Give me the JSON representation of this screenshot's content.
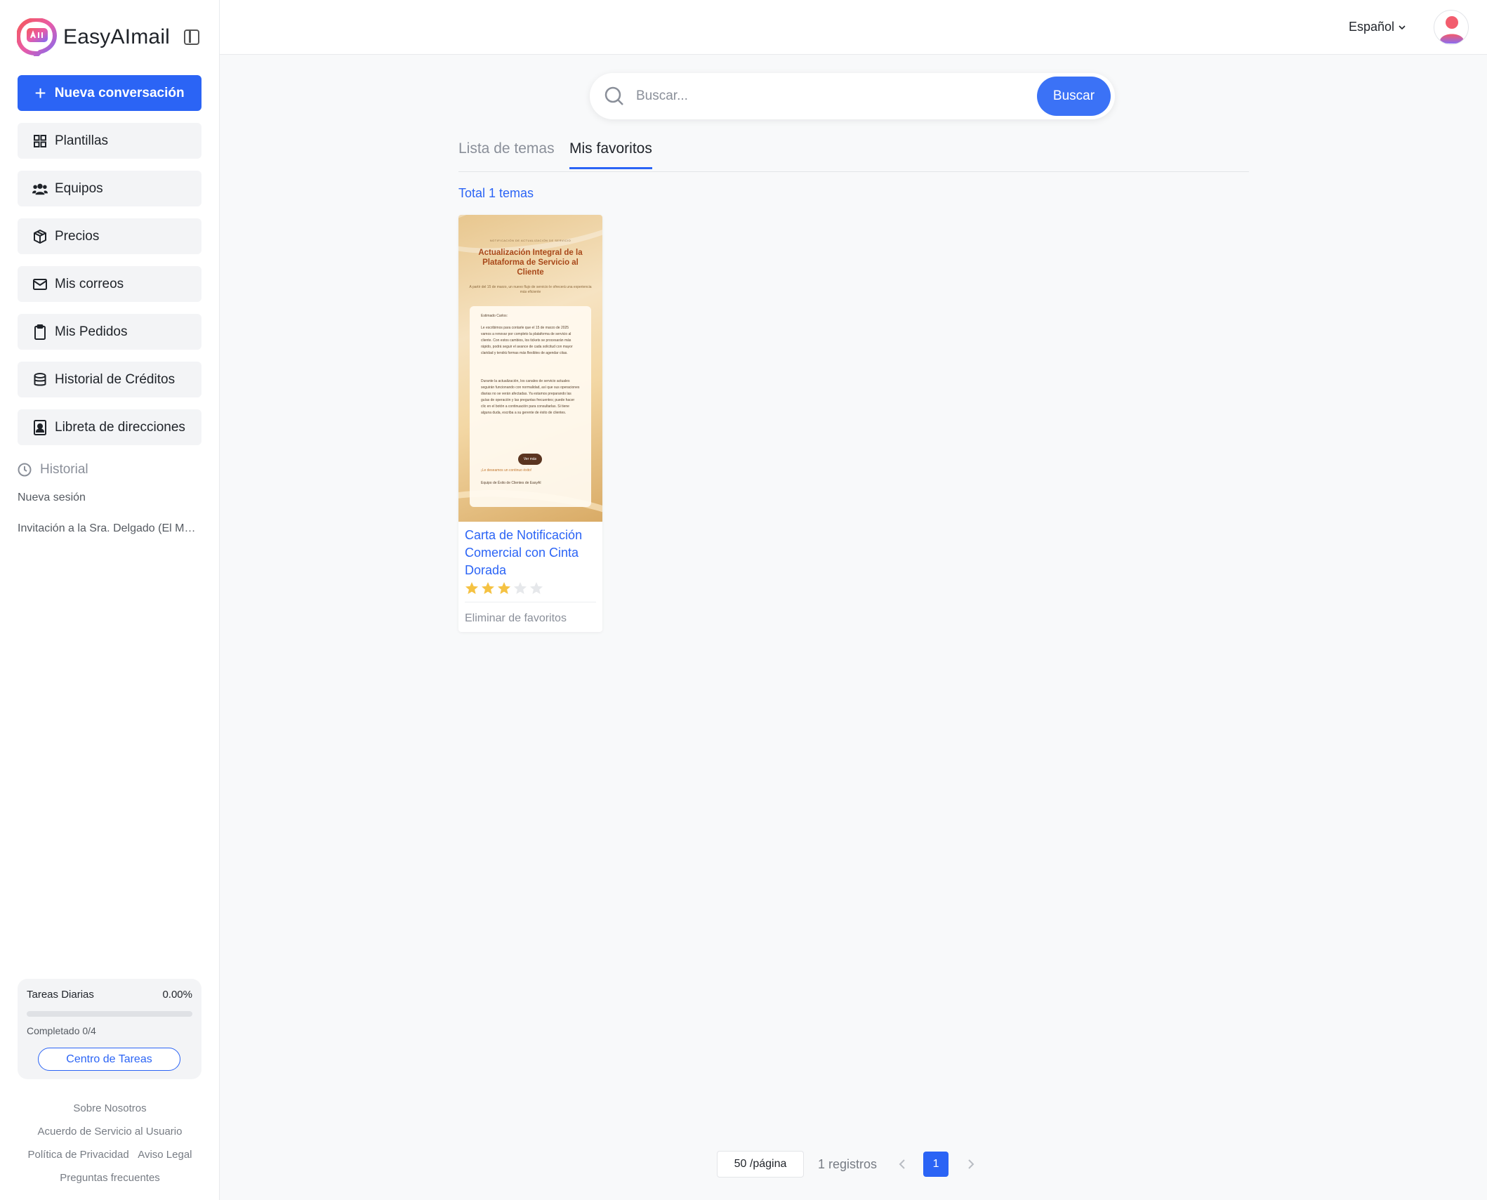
{
  "brand": {
    "name": "EasyAImail"
  },
  "sidebar": {
    "new_conversation": "Nueva conversación",
    "items": [
      {
        "label": "Plantillas",
        "icon": "grid-icon"
      },
      {
        "label": "Equipos",
        "icon": "team-icon"
      },
      {
        "label": "Precios",
        "icon": "box-icon"
      },
      {
        "label": "Mis correos",
        "icon": "mail-icon"
      },
      {
        "label": "Mis Pedidos",
        "icon": "clipboard-icon"
      },
      {
        "label": "Historial de Créditos",
        "icon": "database-icon"
      },
      {
        "label": "Libreta de direcciones",
        "icon": "contact-book-icon"
      }
    ],
    "history_title": "Historial",
    "history": [
      "Nueva sesión",
      "Invitación a la Sra. Delgado (El Mo…"
    ]
  },
  "tasks": {
    "title": "Tareas Diarias",
    "percent_text": "0.00%",
    "progress": 0,
    "completed": "Completado 0/4",
    "button": "Centro de Tareas"
  },
  "footer": {
    "about": "Sobre Nosotros",
    "terms": "Acuerdo de Servicio al Usuario",
    "privacy": "Política de Privacidad",
    "legal": "Aviso Legal",
    "faq": "Preguntas frecuentes"
  },
  "topbar": {
    "language": "Español"
  },
  "search": {
    "placeholder": "Buscar...",
    "button": "Buscar"
  },
  "tabs": [
    {
      "label": "Lista de temas",
      "active": false
    },
    {
      "label": "Mis favoritos",
      "active": true
    }
  ],
  "total_text": "Total 1 temas",
  "cards": [
    {
      "thumbnail": {
        "kicker": "NOTIFICACIÓN DE ACTUALIZACIÓN DE SERVICIO",
        "title": "Actualización Integral de la Plataforma de Servicio al Cliente",
        "subtitle": "A partir del 15 de marzo, un nuevo flujo de servicio le ofrecerá una experiencia más eficiente",
        "greeting": "Estimado Carlos:",
        "para1": "Le escribimos para contarle que el 15 de marzo de 2025 vamos a renovar por completo la plataforma de servicio al cliente. Con estos cambios, los tickets se procesarán más rápido, podrá seguir el avance de cada solicitud con mayor claridad y tendrá formas más flexibles de agendar citas.",
        "para2": "Durante la actualización, los canales de servicio actuales seguirán funcionando con normalidad, así que sus operaciones diarias no se verán afectadas. Ya estamos preparando las guías de operación y las preguntas frecuentes; puede hacer clic en el botón a continuación para consultarlas. Si tiene alguna duda, escriba a su gerente de éxito de clientes.",
        "button": "Ver más",
        "closing": "¡Le deseamos un continuo éxito!",
        "signature": "Equipo de Éxito de Clientes de EasyAI"
      },
      "title": "Carta de Notificación Comercial con Cinta Dorada",
      "rating": 3,
      "max_rating": 5,
      "remove_label": "Eliminar de favoritos"
    }
  ],
  "pagination": {
    "page_size": "50 /página",
    "records": "1 registros",
    "current_page": "1"
  },
  "colors": {
    "accent": "#2b64f5",
    "star": "#f5c242",
    "star_empty": "#e6e8eb"
  }
}
